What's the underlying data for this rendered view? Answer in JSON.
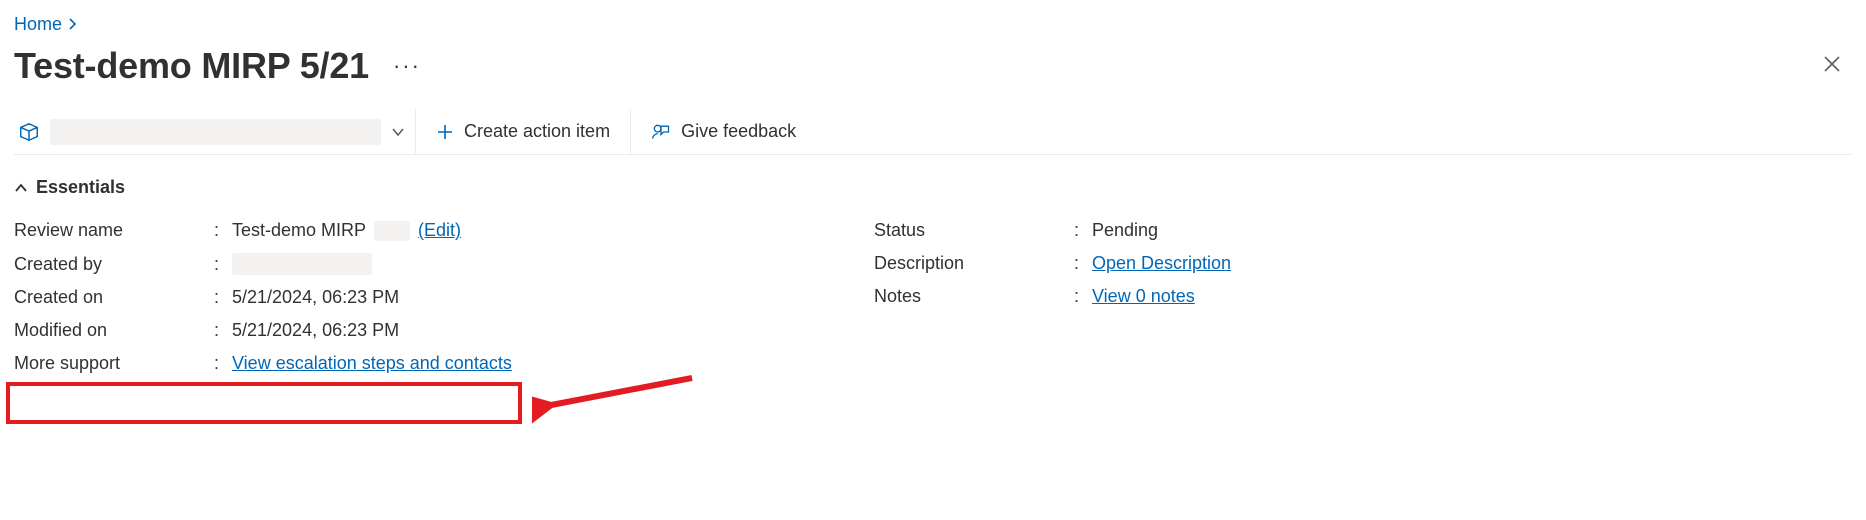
{
  "breadcrumb": {
    "home_label": "Home"
  },
  "header": {
    "title": "Test-demo MIRP 5/21"
  },
  "toolbar": {
    "create_action_label": "Create action item",
    "feedback_label": "Give feedback"
  },
  "essentials": {
    "section_label": "Essentials",
    "left": {
      "review_name_label": "Review name",
      "review_name_value": "Test-demo MIRP",
      "review_name_edit_label": "(Edit)",
      "created_by_label": "Created by",
      "created_on_label": "Created on",
      "created_on_value": "5/21/2024, 06:23 PM",
      "modified_on_label": "Modified on",
      "modified_on_value": "5/21/2024, 06:23 PM",
      "more_support_label": "More support",
      "more_support_link": "View escalation steps and contacts"
    },
    "right": {
      "status_label": "Status",
      "status_value": "Pending",
      "description_label": "Description",
      "description_link": "Open Description",
      "notes_label": "Notes",
      "notes_link": "View 0 notes"
    }
  }
}
